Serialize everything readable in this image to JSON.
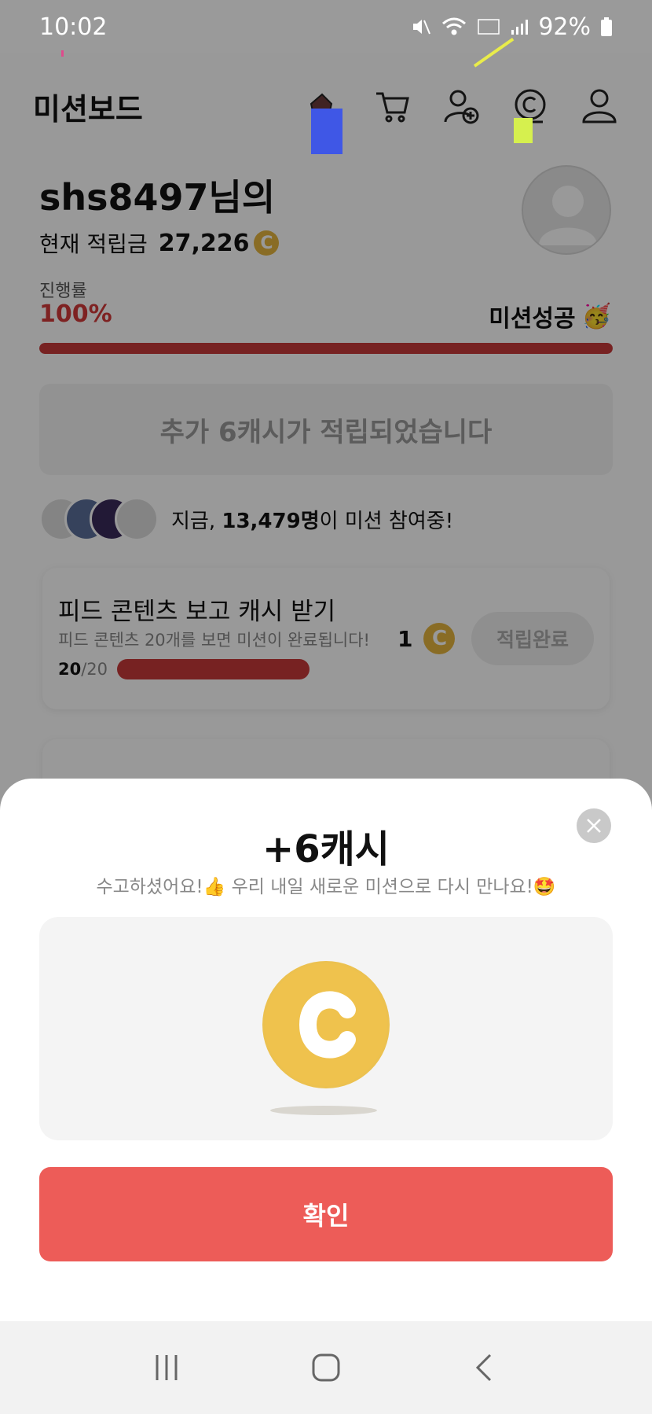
{
  "status_bar": {
    "time": "10:02",
    "battery": "92%"
  },
  "header": {
    "title": "미션보드"
  },
  "user": {
    "name": "shs8497님의",
    "points_label": "현재 적립금",
    "points": "27,226"
  },
  "progress": {
    "label": "진행률",
    "value_text": "100%",
    "value": 1.0,
    "status": "미션성공",
    "status_emoji": "🥳"
  },
  "notice": {
    "text": "추가 6캐시가 적립되었습니다"
  },
  "participants": {
    "prefix": "지금,",
    "count": "13,479명",
    "suffix": "이 미션 참여중!"
  },
  "mission_card": {
    "title": "피드 콘텐츠 보고 캐시 받기",
    "description": "피드 콘텐츠 20개를 보면 미션이 완료됩니다!",
    "progress_current": "20",
    "progress_total": "/20",
    "reward": "1",
    "button": "적립완료"
  },
  "coin_symbol": "C",
  "sheet": {
    "title": "+6캐시",
    "subtitle": "수고하셨어요!👍 우리 내일 새로운 미션으로 다시 만나요!🤩",
    "confirm": "확인"
  },
  "colors": {
    "accent_red": "#ed5c58",
    "progress_red": "#c63a3a",
    "coin_gold": "#ecc14f",
    "annotation_blue": "#3f57e6",
    "annotation_yellow": "#d6f04e"
  }
}
